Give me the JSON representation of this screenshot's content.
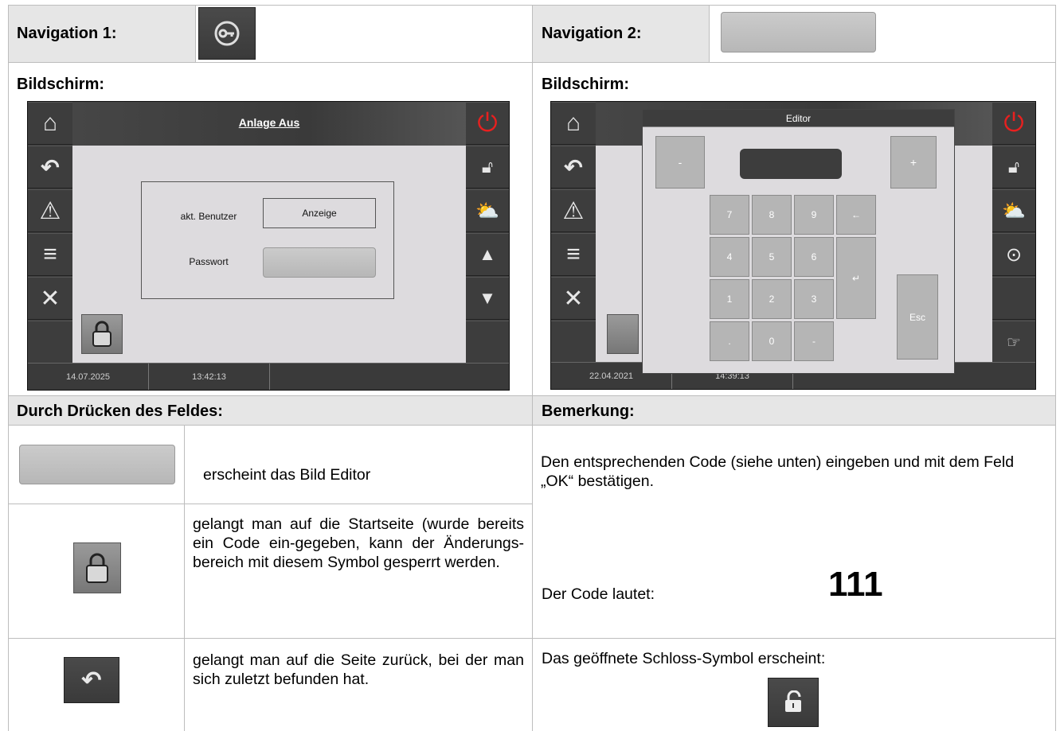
{
  "row1": {
    "nav1_label": "Navigation 1:",
    "nav2_label": "Navigation 2:"
  },
  "row2": {
    "screen_label_left": "Bildschirm:",
    "screen_label_right": "Bildschirm:"
  },
  "screen1": {
    "title": "Anlage Aus",
    "user_label": "akt. Benutzer",
    "user_value": "Anzeige",
    "password_label": "Passwort",
    "date": "14.07.2025",
    "time": "13:42:13"
  },
  "screen2": {
    "editor_title": "Editor",
    "minus": "-",
    "plus": "+",
    "keys": [
      "7",
      "8",
      "9",
      "4",
      "5",
      "6",
      "1",
      "2",
      "3",
      ".",
      "0",
      "-"
    ],
    "backspace": "←",
    "enter": "↵",
    "esc": "Esc",
    "date": "22.04.2021",
    "time": "14:39:13"
  },
  "row3": {
    "left_header": "Durch Drücken des Feldes:",
    "right_header": "Bemerkung:"
  },
  "row4": {
    "text": "erscheint das Bild Editor",
    "remark": "Den entsprechenden Code (siehe unten) eingeben und mit dem Feld „OK“ bestätigen."
  },
  "row5": {
    "text": "gelangt man auf die Startseite (wurde bereits ein Code ein-gegeben, kann der Änderungs-bereich mit diesem Symbol gesperrt werden.",
    "code_label": "Der Code lautet:",
    "code_value": "111"
  },
  "row6": {
    "text": "gelangt man auf die Seite zurück, bei der man sich zuletzt befunden hat.",
    "remark": "Das geöffnete Schloss-Symbol erscheint:"
  },
  "colors": {
    "header_bg": "#e6e6e6",
    "power_red": "#e8201f",
    "screen_dark": "#3d3d3d"
  }
}
